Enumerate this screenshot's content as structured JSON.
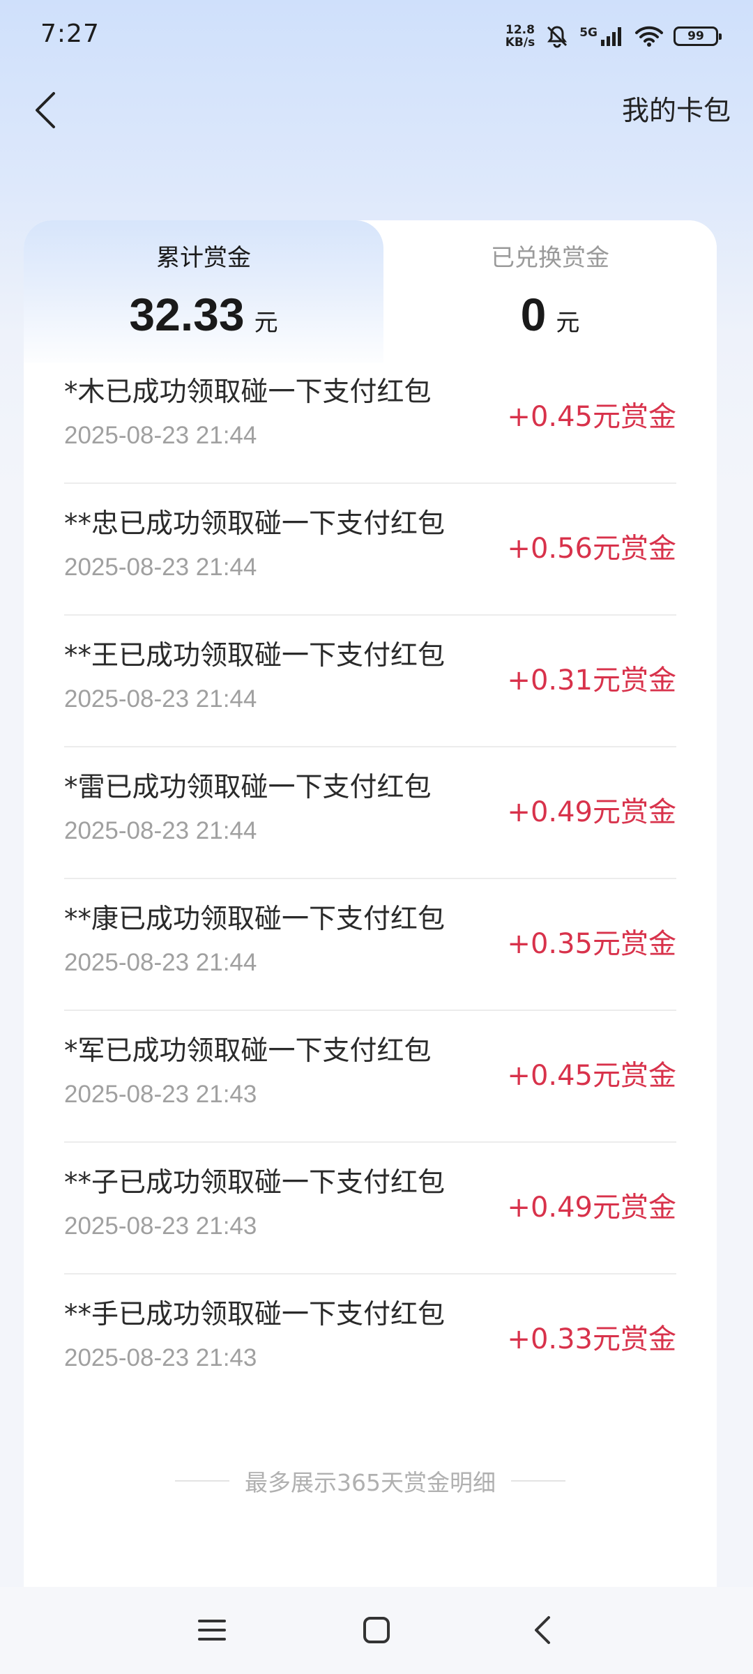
{
  "status_bar": {
    "time": "7:27",
    "net_speed_value": "12.8",
    "net_speed_unit": "KB/s",
    "signal_type": "5G",
    "battery": "99",
    "icons": [
      "bell-muted-icon",
      "signal-icon",
      "wifi-icon",
      "battery-icon"
    ]
  },
  "header": {
    "back_icon": "chevron-left-icon",
    "action_label": "我的卡包"
  },
  "tabs": [
    {
      "label": "累计赏金",
      "amount": "32.33",
      "unit": "元",
      "active": true
    },
    {
      "label": "已兑换赏金",
      "amount": "0",
      "unit": "元",
      "active": false
    }
  ],
  "records": [
    {
      "title": "*木已成功领取碰一下支付红包",
      "time": "2025-08-23 21:44",
      "reward": "+0.45元赏金"
    },
    {
      "title": "**忠已成功领取碰一下支付红包",
      "time": "2025-08-23 21:44",
      "reward": "+0.56元赏金"
    },
    {
      "title": "**王已成功领取碰一下支付红包",
      "time": "2025-08-23 21:44",
      "reward": "+0.31元赏金"
    },
    {
      "title": "*雷已成功领取碰一下支付红包",
      "time": "2025-08-23 21:44",
      "reward": "+0.49元赏金"
    },
    {
      "title": "**康已成功领取碰一下支付红包",
      "time": "2025-08-23 21:44",
      "reward": "+0.35元赏金"
    },
    {
      "title": "*军已成功领取碰一下支付红包",
      "time": "2025-08-23 21:43",
      "reward": "+0.45元赏金"
    },
    {
      "title": "**子已成功领取碰一下支付红包",
      "time": "2025-08-23 21:43",
      "reward": "+0.49元赏金"
    },
    {
      "title": "**手已成功领取碰一下支付红包",
      "time": "2025-08-23 21:43",
      "reward": "+0.33元赏金"
    }
  ],
  "footer_note": "最多展示365天赏金明细",
  "nav_bar": {
    "icons": [
      "menu-icon",
      "home-icon",
      "back-icon"
    ]
  },
  "colors": {
    "reward": "#d8324b",
    "accent_bg": "#cfe0fb"
  }
}
